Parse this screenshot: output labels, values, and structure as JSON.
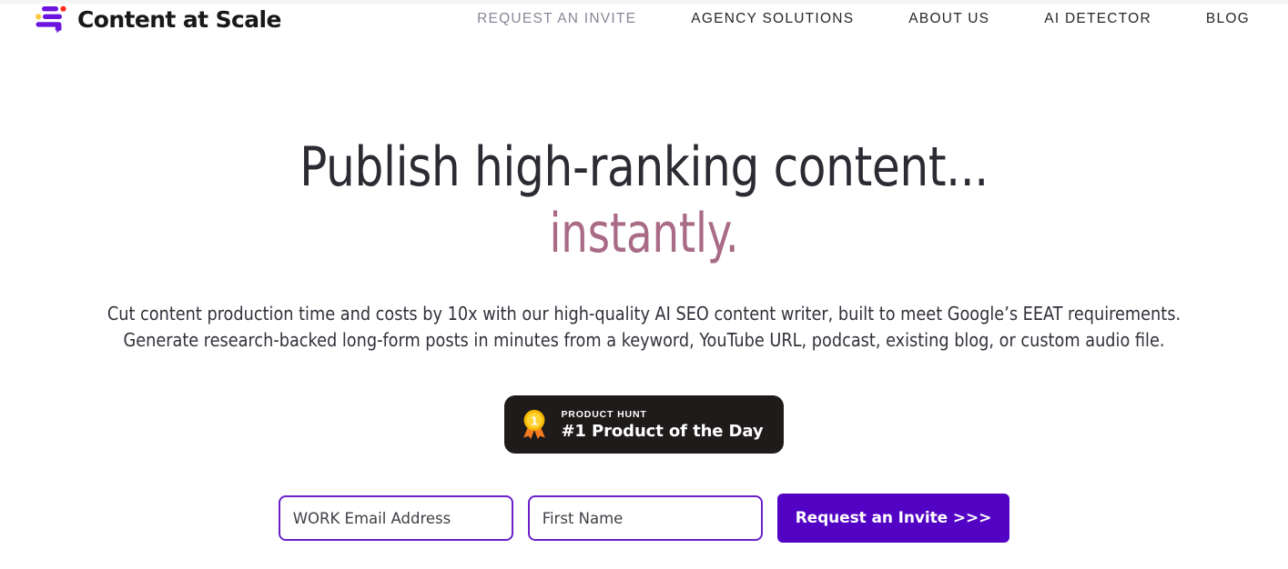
{
  "brand": {
    "name": "Content at Scale",
    "logo_icon": "content-at-scale-logo",
    "colors": {
      "logo_purple": "#6b14e0",
      "logo_red": "#ff2d20",
      "logo_yellow": "#ffc83d"
    }
  },
  "nav": {
    "items": [
      {
        "label": "REQUEST AN INVITE",
        "name": "nav-request-an-invite",
        "muted": true
      },
      {
        "label": "AGENCY SOLUTIONS",
        "name": "nav-agency-solutions",
        "muted": false
      },
      {
        "label": "ABOUT US",
        "name": "nav-about-us",
        "muted": false
      },
      {
        "label": "AI DETECTOR",
        "name": "nav-ai-detector",
        "muted": false
      },
      {
        "label": "BLOG",
        "name": "nav-blog",
        "muted": false
      }
    ]
  },
  "hero": {
    "headline": "Publish high-ranking content...",
    "headline_accent": "instantly.",
    "headline_accent_color": "#a96b86",
    "subhead_line1": "Cut content production time and costs by 10x with our high-quality AI SEO content writer, built to meet Google’s EEAT requirements.",
    "subhead_line2": "Generate research-backed long-form posts in minutes from a keyword, YouTube URL, podcast, existing blog, or custom audio file."
  },
  "product_hunt_badge": {
    "kicker": "PRODUCT HUNT",
    "title": "#1 Product of the Day",
    "medal_icon": "gold-medal-icon",
    "medal_number": "1",
    "background": "#1f1b1b"
  },
  "form": {
    "email_placeholder": "WORK Email Address",
    "email_value": "",
    "first_name_placeholder": "First Name",
    "first_name_value": "",
    "submit_label": "Request an Invite >>>",
    "submit_color": "#5203c3",
    "field_border_color": "#6b20c9"
  }
}
